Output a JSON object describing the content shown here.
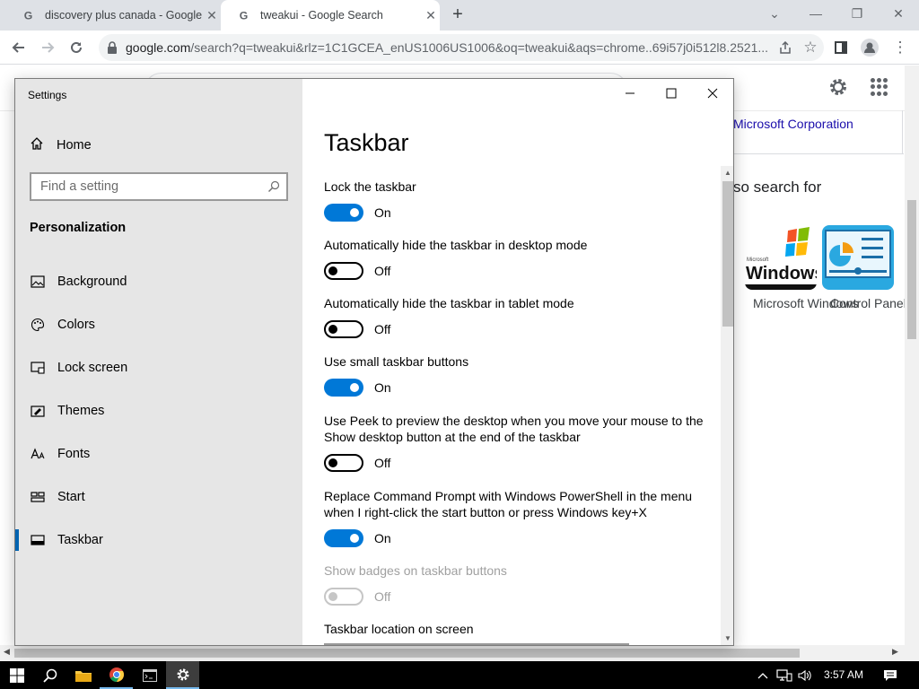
{
  "browser": {
    "tabs": [
      {
        "title": "discovery plus canada - Google Search",
        "active": false
      },
      {
        "title": "tweakui - Google Search",
        "active": true
      }
    ],
    "url_domain": "google.com",
    "url_rest": "/search?q=tweakui&rlz=1C1GCEA_enUS1006US1006&oq=tweakui&aqs=chrome..69i57j0i512l8.2521..."
  },
  "google": {
    "publisher": "Microsoft Corporation",
    "also_search_for": "so search for",
    "related": [
      {
        "label": "Microsoft Windows"
      },
      {
        "label": "Control Panel"
      }
    ],
    "windows_logo_small": "Microsoft",
    "windows_logo_big": "Windows"
  },
  "settings": {
    "app_title": "Settings",
    "home_label": "Home",
    "search_placeholder": "Find a setting",
    "section": "Personalization",
    "nav": [
      {
        "label": "Background",
        "icon": "picture-icon"
      },
      {
        "label": "Colors",
        "icon": "palette-icon"
      },
      {
        "label": "Lock screen",
        "icon": "lock-screen-icon"
      },
      {
        "label": "Themes",
        "icon": "brush-icon"
      },
      {
        "label": "Fonts",
        "icon": "font-icon"
      },
      {
        "label": "Start",
        "icon": "start-icon"
      },
      {
        "label": "Taskbar",
        "icon": "taskbar-icon",
        "selected": true
      }
    ],
    "page_title": "Taskbar",
    "options": [
      {
        "label": "Lock the taskbar",
        "state": "On"
      },
      {
        "label": "Automatically hide the taskbar in desktop mode",
        "state": "Off"
      },
      {
        "label": "Automatically hide the taskbar in tablet mode",
        "state": "Off"
      },
      {
        "label": "Use small taskbar buttons",
        "state": "On"
      },
      {
        "label": "Use Peek to preview the desktop when you move your mouse to the Show desktop button at the end of the taskbar",
        "state": "Off"
      },
      {
        "label": "Replace Command Prompt with Windows PowerShell in the menu when I right-click the start button or press Windows key+X",
        "state": "On"
      },
      {
        "label": "Show badges on taskbar buttons",
        "state": "Off",
        "disabled": true
      }
    ],
    "location_label": "Taskbar location on screen"
  },
  "taskbar": {
    "time": "3:57 AM"
  },
  "colors": {
    "accent": "#0078d7",
    "selection_bar": "#0063b1",
    "link": "#1a0dab"
  }
}
